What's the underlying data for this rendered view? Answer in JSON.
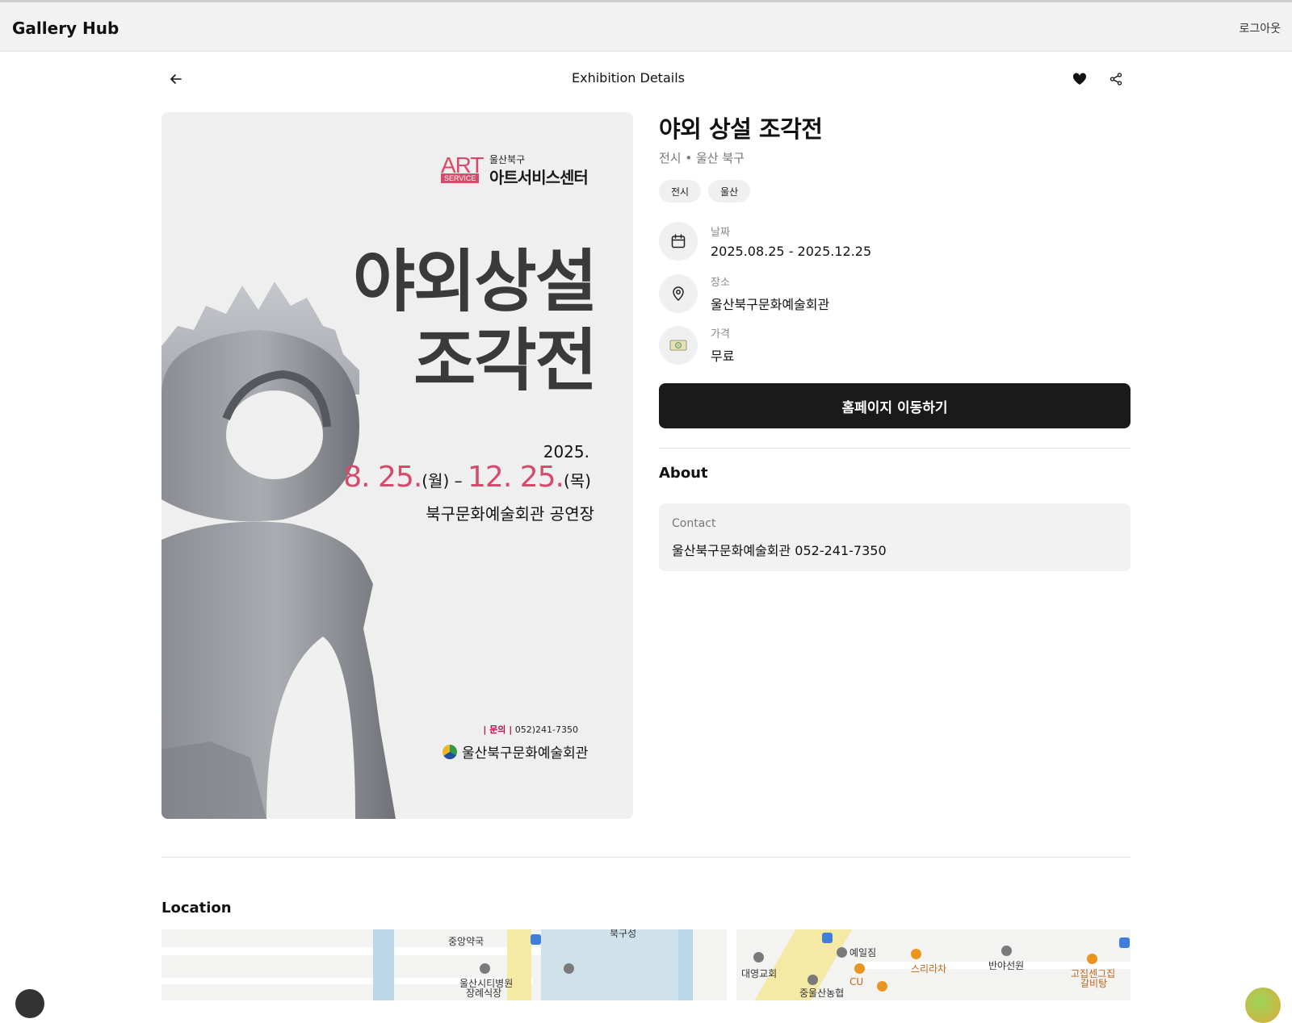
{
  "app": {
    "brand": "Gallery Hub",
    "logout_label": "로그아웃"
  },
  "header": {
    "title": "Exhibition Details",
    "back_icon": "arrow-left-icon",
    "favorite_icon": "heart-icon",
    "share_icon": "share-icon"
  },
  "poster": {
    "logo_art": "ART",
    "logo_service": "SERVICE",
    "logo_sub": "울산북구",
    "logo_main": "아트서비스센터",
    "title_line1": "야외상설",
    "title_line2": "조각전",
    "year": "2025.",
    "start_date": "8. 25.",
    "start_day": "(월)",
    "dash": " – ",
    "end_date": "12. 25.",
    "end_day": "(목)",
    "venue": "북구문화예술회관 공연장",
    "contact_label": "| 문의 |",
    "contact_number": "052)241-7350",
    "organizer": "울산북구문화예술회관",
    "accent_color": "#d64a6a"
  },
  "exhibition": {
    "title": "야외 상설 조각전",
    "subtitle": "전시 • 울산 북구",
    "tags": [
      "전시",
      "울산"
    ],
    "date_label": "날짜",
    "date_value": "2025.08.25 - 2025.12.25",
    "place_label": "장소",
    "place_value": "울산북구문화예술회관",
    "price_label": "가격",
    "price_value": "무료",
    "homepage_button": "홈페이지 이동하기",
    "about_heading": "About",
    "contact_label": "Contact",
    "contact_value": "울산북구문화예술회관 052-241-7350"
  },
  "location": {
    "heading": "Location",
    "map_labels": {
      "pharmacy": "중앙약국",
      "hospital": "울산시티병원",
      "funeral": "장례식장",
      "castle": "북구성",
      "church": "대영교회",
      "gym": "예일짐",
      "nh_bank": "중울산농협",
      "cu": "CU",
      "restaurant": "스리라차",
      "banya": "반야선원",
      "galbi_1": "고집센그집",
      "galbi_2": "갈비탕"
    }
  }
}
